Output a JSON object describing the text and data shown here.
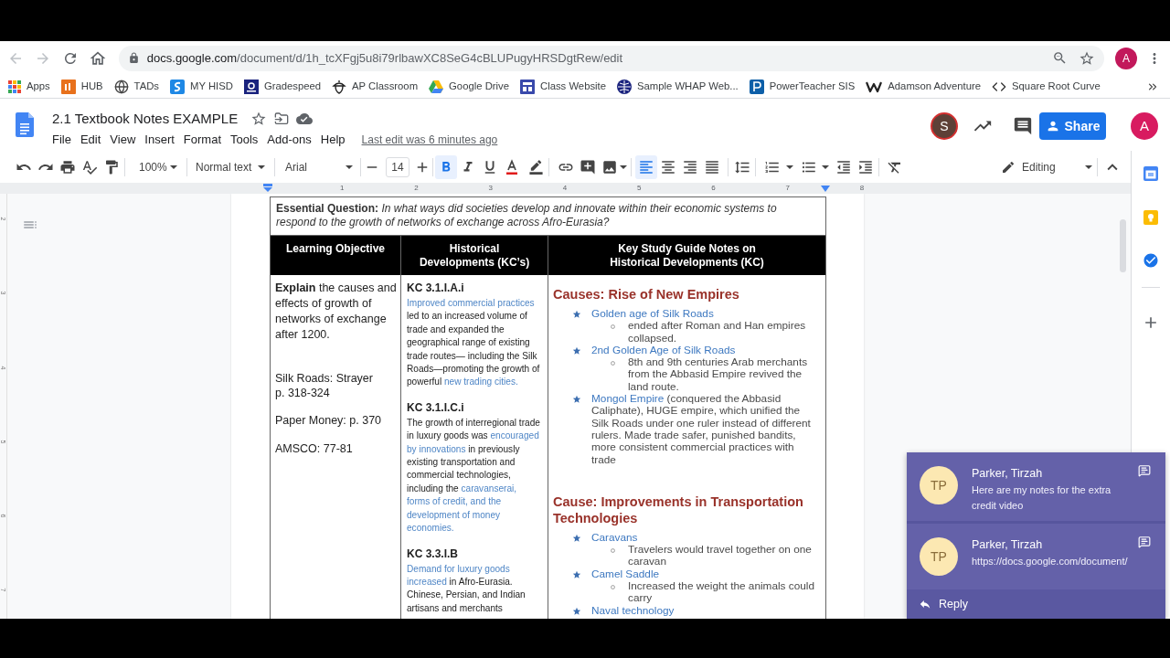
{
  "browser": {
    "url_host": "docs.google.com",
    "url_path": "/document/d/1h_tcXFgj5u8i79rlbawXC8SeG4cBLUPugyHRSDgtRew/edit",
    "profile_initial": "A",
    "bookmarks": [
      {
        "kind": "apps",
        "label": "Apps"
      },
      {
        "kind": "hub",
        "label": "HUB"
      },
      {
        "kind": "globe",
        "label": "TADs"
      },
      {
        "kind": "hisd",
        "label": "MY HISD"
      },
      {
        "kind": "gradespeed",
        "label": "Gradespeed"
      },
      {
        "kind": "acorn",
        "label": "AP Classroom"
      },
      {
        "kind": "drive",
        "label": "Google Drive"
      },
      {
        "kind": "layout",
        "label": "Class Website"
      },
      {
        "kind": "sphere",
        "label": "Sample WHAP Web..."
      },
      {
        "kind": "powerteacher",
        "label": "PowerTeacher SIS"
      },
      {
        "kind": "weebly",
        "label": "Adamson Adventure"
      },
      {
        "kind": "code",
        "label": "Square Root Curve"
      }
    ]
  },
  "docs_header": {
    "title": "2.1 Textbook Notes EXAMPLE",
    "menu": [
      "File",
      "Edit",
      "View",
      "Insert",
      "Format",
      "Tools",
      "Add-ons",
      "Help"
    ],
    "last_edit": "Last edit was 6 minutes ago",
    "collaborator_initial": "S",
    "share_label": "Share",
    "account_initial": "A"
  },
  "toolbar": {
    "zoom": "100%",
    "style": "Normal text",
    "font": "Arial",
    "font_size": "14",
    "format_buttons": [
      {
        "kind": "bold",
        "selected": true
      },
      {
        "kind": "italic",
        "selected": false
      },
      {
        "kind": "underline",
        "selected": false
      }
    ],
    "align_buttons": [
      {
        "kind": "left",
        "selected": true
      },
      {
        "kind": "center",
        "selected": false
      },
      {
        "kind": "right",
        "selected": false
      },
      {
        "kind": "justify",
        "selected": false
      }
    ],
    "mode": "Editing"
  },
  "ruler": {
    "marks": [
      "1",
      "2",
      "3",
      "4",
      "5",
      "6",
      "7",
      "8"
    ]
  },
  "vertical_ruler": {
    "marks": [
      "2",
      "3",
      "4",
      "5",
      "6",
      "7"
    ]
  },
  "document": {
    "question": "**Essential Question:** *In what ways did societies develop and innovate within their economic systems to respond to the growth of networks of exchange across Afro-Eurasia?*",
    "columns": [
      "Learning Objective",
      "Historical Developments (KC’s)",
      "Key Study Guide Notes on Historical Developments (KC)"
    ],
    "objective": {
      "text": "**Explain** the causes and effects of growth of networks of exchange after 1200.",
      "readings": [
        "Silk Roads: Strayer\np. 318-324",
        "Paper Money: p. 370",
        "AMSCO: 77-81"
      ]
    },
    "kcs": [
      {
        "code": "KC 3.1.I.A.i",
        "segments": [
          {
            "text": "Improved commercial practices",
            "accent": true
          },
          {
            "text": " led to an increased volume of trade and expanded the geographical range of existing trade routes— including the Silk Roads—promoting the growth of powerful ",
            "accent": false
          },
          {
            "text": "new trading cities.",
            "accent": true
          }
        ]
      },
      {
        "code": "KC 3.1.I.C.i",
        "segments": [
          {
            "text": "The growth of interregional trade in luxury goods was ",
            "accent": false
          },
          {
            "text": "encouraged by innovations",
            "accent": true
          },
          {
            "text": " in previously existing transportation and commercial technologies, including the ",
            "accent": false
          },
          {
            "text": "caravanserai, forms of credit, and the development of money economies.",
            "accent": true
          }
        ]
      },
      {
        "code": "KC 3.3.I.B",
        "segments": [
          {
            "text": "Demand for luxury goods increased",
            "accent": true
          },
          {
            "text": " in Afro-Eurasia. Chinese, Persian, and Indian artisans and merchants",
            "accent": false
          }
        ]
      }
    ],
    "notes": [
      {
        "heading": "Causes: Rise of New Empires",
        "items": [
          {
            "segments": [
              {
                "text": "Golden age of Silk Roads",
                "accent": true
              }
            ],
            "children": [
              {
                "text": "ended after Roman and Han empires collapsed."
              }
            ]
          },
          {
            "segments": [
              {
                "text": "2nd Golden Age of Silk Roads",
                "accent": true
              }
            ],
            "children": [
              {
                "text": "8th and 9th centuries Arab merchants from the Abbasid Empire revived the land route."
              }
            ]
          },
          {
            "segments": [
              {
                "text": "Mongol Empire",
                "accent": true
              },
              {
                "text": " (conquered the Abbasid Caliphate), HUGE empire, which unified the Silk Roads under one ruler instead of different rulers. Made trade safer, punished bandits, more consistent commercial practices with trade",
                "accent": false
              }
            ]
          }
        ]
      },
      {
        "heading": "Cause: Improvements in Transportation Technologies",
        "items": [
          {
            "segments": [
              {
                "text": "Caravans",
                "accent": true
              }
            ],
            "children": [
              {
                "text": "Travelers would travel together on one caravan"
              }
            ]
          },
          {
            "segments": [
              {
                "text": "Camel Saddle",
                "accent": true
              }
            ],
            "children": [
              {
                "text": "Increased the weight the animals could carry"
              }
            ]
          },
          {
            "segments": [
              {
                "text": "Naval technology",
                "accent": true
              }
            ]
          }
        ]
      }
    ]
  },
  "comments": {
    "items": [
      {
        "initials": "TP",
        "author": "Parker, Tirzah",
        "text": "Here are my notes for the extra credit video"
      },
      {
        "initials": "TP",
        "author": "Parker, Tirzah",
        "text": "https://docs.google.com/document/"
      }
    ],
    "reply": "Reply"
  }
}
